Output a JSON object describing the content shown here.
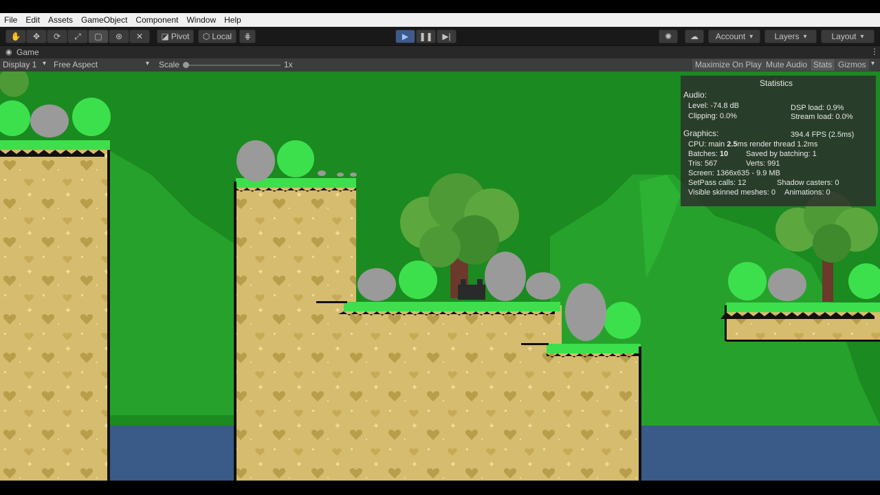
{
  "menu": [
    "File",
    "Edit",
    "Assets",
    "GameObject",
    "Component",
    "Window",
    "Help"
  ],
  "toolbar": {
    "pivot": "Pivot",
    "local": "Local",
    "account": "Account",
    "layers": "Layers",
    "layout": "Layout"
  },
  "game_tab": {
    "title": "Game"
  },
  "game_controls": {
    "display": "Display 1",
    "aspect": "Free Aspect",
    "scale_label": "Scale",
    "scale_value": "1x",
    "maximize": "Maximize On Play",
    "mute": "Mute Audio",
    "stats": "Stats",
    "gizmos": "Gizmos"
  },
  "stats": {
    "title": "Statistics",
    "audio_header": "Audio:",
    "level": "Level: -74.8 dB",
    "clipping": "Clipping: 0.0%",
    "dsp": "DSP load: 0.9%",
    "stream": "Stream load: 0.0%",
    "graphics_header": "Graphics:",
    "fps": "394.4 FPS (2.5ms)",
    "cpu_prefix": "CPU: main ",
    "cpu_main": "2.5",
    "cpu_suffix": "ms  render thread 1.2ms",
    "batches_prefix": "Batches: ",
    "batches": "10",
    "saved": "Saved by batching: 1",
    "tris": "Tris: 567",
    "verts": "Verts: 991",
    "screen": "Screen: 1366x635 - 9.9 MB",
    "setpass": "SetPass calls: 12",
    "shadow": "Shadow casters: 0",
    "skinned": "Visible skinned meshes: 0",
    "animations": "Animations: 0"
  },
  "colors": {
    "accent_play": "#3d5a8a",
    "sky_green": "#1b8a20",
    "hill_green": "#26a22c",
    "water": "#3a5a88",
    "dirt": "#d6bc6e",
    "grass": "#3ce04c"
  }
}
